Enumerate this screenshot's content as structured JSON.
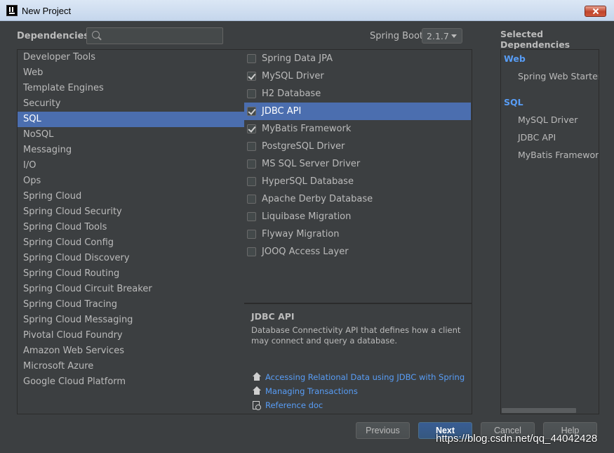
{
  "window": {
    "title": "New Project"
  },
  "header": {
    "dependencies_label": "Dependencies",
    "search_placeholder": "",
    "spring_boot_label": "Spring Boot",
    "spring_boot_version": "2.1.7",
    "selected_dependencies_label": "Selected Dependencies"
  },
  "categories": [
    "Developer Tools",
    "Web",
    "Template Engines",
    "Security",
    "SQL",
    "NoSQL",
    "Messaging",
    "I/O",
    "Ops",
    "Spring Cloud",
    "Spring Cloud Security",
    "Spring Cloud Tools",
    "Spring Cloud Config",
    "Spring Cloud Discovery",
    "Spring Cloud Routing",
    "Spring Cloud Circuit Breaker",
    "Spring Cloud Tracing",
    "Spring Cloud Messaging",
    "Pivotal Cloud Foundry",
    "Amazon Web Services",
    "Microsoft Azure",
    "Google Cloud Platform"
  ],
  "selected_category": "SQL",
  "dependencies": [
    {
      "label": "Spring Data JPA",
      "checked": false
    },
    {
      "label": "MySQL Driver",
      "checked": true
    },
    {
      "label": "H2 Database",
      "checked": false
    },
    {
      "label": "JDBC API",
      "checked": true
    },
    {
      "label": "MyBatis Framework",
      "checked": true
    },
    {
      "label": "PostgreSQL Driver",
      "checked": false
    },
    {
      "label": "MS SQL Server Driver",
      "checked": false
    },
    {
      "label": "HyperSQL Database",
      "checked": false
    },
    {
      "label": "Apache Derby Database",
      "checked": false
    },
    {
      "label": "Liquibase Migration",
      "checked": false
    },
    {
      "label": "Flyway Migration",
      "checked": false
    },
    {
      "label": "JOOQ Access Layer",
      "checked": false
    }
  ],
  "selected_dependency": "JDBC API",
  "description": {
    "title": "JDBC API",
    "text": "Database Connectivity API that defines how a client may connect and query a database.",
    "links": [
      {
        "label": "Accessing Relational Data using JDBC with Spring",
        "icon": "home-icon"
      },
      {
        "label": "Managing Transactions",
        "icon": "home-icon"
      },
      {
        "label": "Reference doc",
        "icon": "doc-search-icon"
      }
    ]
  },
  "selected": {
    "groups": [
      {
        "name": "Web",
        "items": [
          "Spring Web Starter"
        ]
      },
      {
        "name": "SQL",
        "items": [
          "MySQL Driver",
          "JDBC API",
          "MyBatis Framework"
        ]
      }
    ]
  },
  "buttons": {
    "previous": "Previous",
    "next": "Next",
    "cancel": "Cancel",
    "help": "Help"
  },
  "watermark": "https://blog.csdn.net/qq_44042428",
  "colors": {
    "accent": "#4b6eaf",
    "link": "#589df6",
    "background": "#3c3f41"
  }
}
